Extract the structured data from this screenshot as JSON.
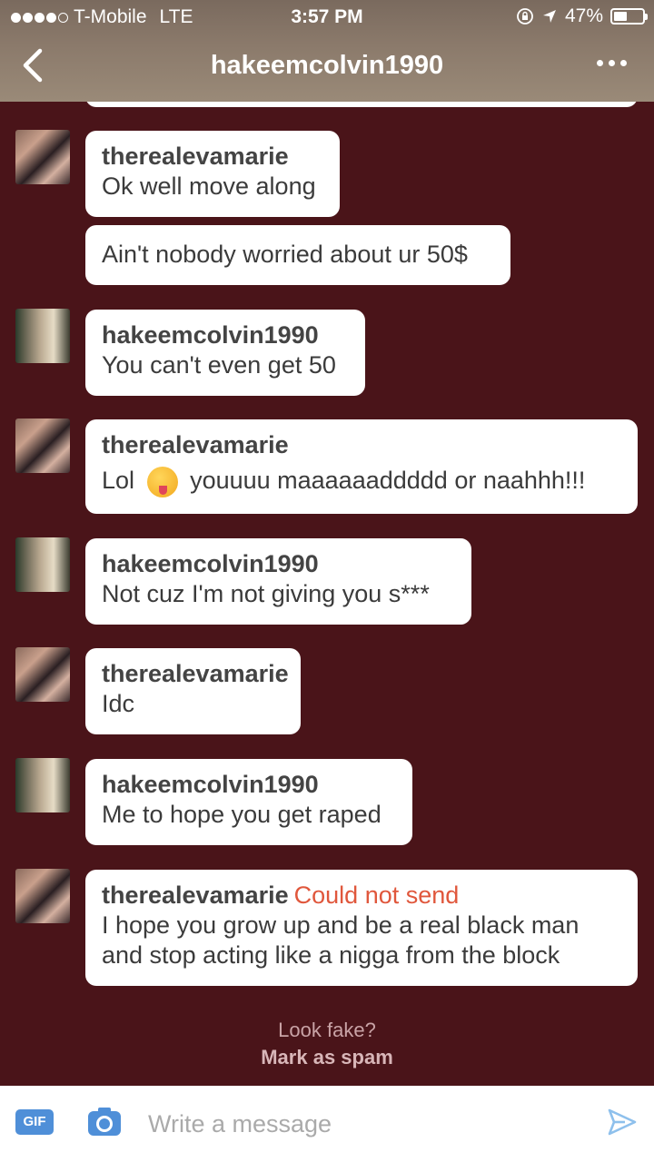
{
  "status": {
    "carrier": "T-Mobile",
    "network": "LTE",
    "time": "3:57 PM",
    "battery": "47%",
    "battery_level": 0.47
  },
  "header": {
    "title": "hakeemcolvin1990",
    "back_icon": "chevron-left-icon",
    "more_icon": "more-dots-icon"
  },
  "messages": [
    {
      "sender": "therealevamarie",
      "text": "Ok well move along"
    },
    {
      "sender": "",
      "text": "Ain't nobody worried about ur 50$"
    },
    {
      "sender": "hakeemcolvin1990",
      "text": "You can't even get 50"
    },
    {
      "sender": "therealevamarie",
      "text_before": "Lol",
      "emoji": "tongue-out-emoji",
      "text_after": "youuuu maaaaaaddddd or naahhh!!!"
    },
    {
      "sender": "hakeemcolvin1990",
      "text": "Not cuz I'm not giving you s***"
    },
    {
      "sender": "therealevamarie",
      "text": "Idc"
    },
    {
      "sender": "hakeemcolvin1990",
      "text": "Me to hope you get raped"
    },
    {
      "sender": "therealevamarie",
      "status": "Could not send",
      "text": "I hope you grow up and be a real black man and stop acting like a nigga from the block"
    }
  ],
  "spam": {
    "question": "Look fake?",
    "link": "Mark as spam"
  },
  "composer": {
    "gif_label": "GIF",
    "placeholder": "Write a message",
    "camera_icon": "camera-icon",
    "send_icon": "send-icon"
  },
  "colors": {
    "background": "#4a1419",
    "error": "#e0573c",
    "gif": "#4f8fd8"
  }
}
